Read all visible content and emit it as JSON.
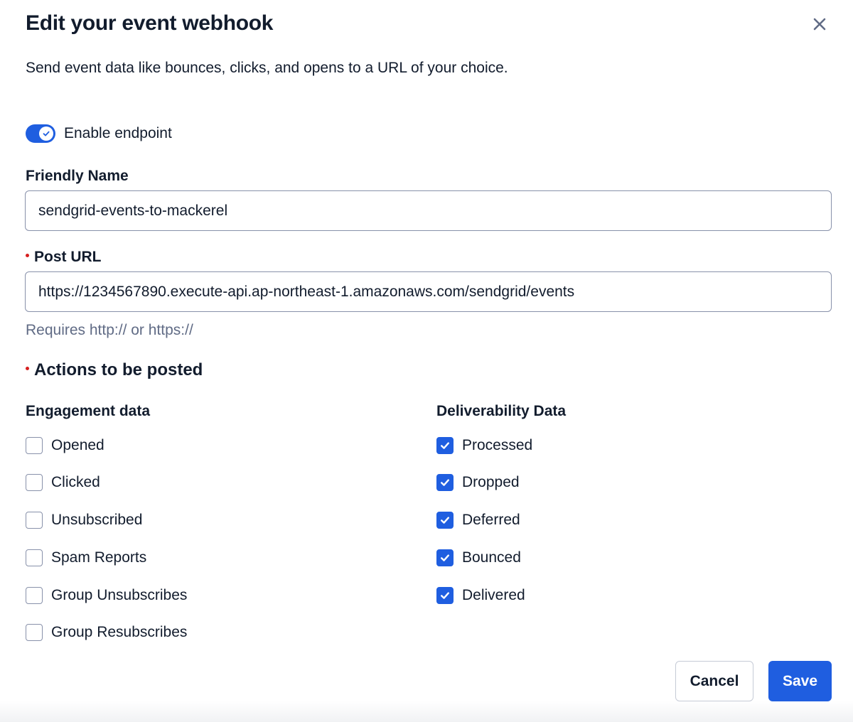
{
  "dialog": {
    "title": "Edit your event webhook",
    "subtitle": "Send event data like bounces, clicks, and opens to a URL of your choice."
  },
  "endpoint_toggle": {
    "label": "Enable endpoint",
    "enabled": true
  },
  "friendly_name": {
    "label": "Friendly Name",
    "value": "sendgrid-events-to-mackerel"
  },
  "post_url": {
    "label": "Post URL",
    "value": "https://1234567890.execute-api.ap-northeast-1.amazonaws.com/sendgrid/events",
    "helper": "Requires http:// or https://"
  },
  "actions": {
    "title": "Actions to be posted",
    "engagement": {
      "heading": "Engagement data",
      "items": [
        {
          "label": "Opened",
          "checked": false
        },
        {
          "label": "Clicked",
          "checked": false
        },
        {
          "label": "Unsubscribed",
          "checked": false
        },
        {
          "label": "Spam Reports",
          "checked": false
        },
        {
          "label": "Group Unsubscribes",
          "checked": false
        },
        {
          "label": "Group Resubscribes",
          "checked": false
        }
      ]
    },
    "deliverability": {
      "heading": "Deliverability Data",
      "items": [
        {
          "label": "Processed",
          "checked": true
        },
        {
          "label": "Dropped",
          "checked": true
        },
        {
          "label": "Deferred",
          "checked": true
        },
        {
          "label": "Bounced",
          "checked": true
        },
        {
          "label": "Delivered",
          "checked": true
        }
      ]
    }
  },
  "footer": {
    "cancel_label": "Cancel",
    "save_label": "Save"
  },
  "colors": {
    "accent": "#1f5ee0",
    "required": "#d61f1f",
    "text": "#121c2d",
    "muted": "#606b85"
  },
  "icons": {
    "close": "close-icon",
    "toggle_check": "check-icon",
    "checkbox_check": "check-icon"
  }
}
